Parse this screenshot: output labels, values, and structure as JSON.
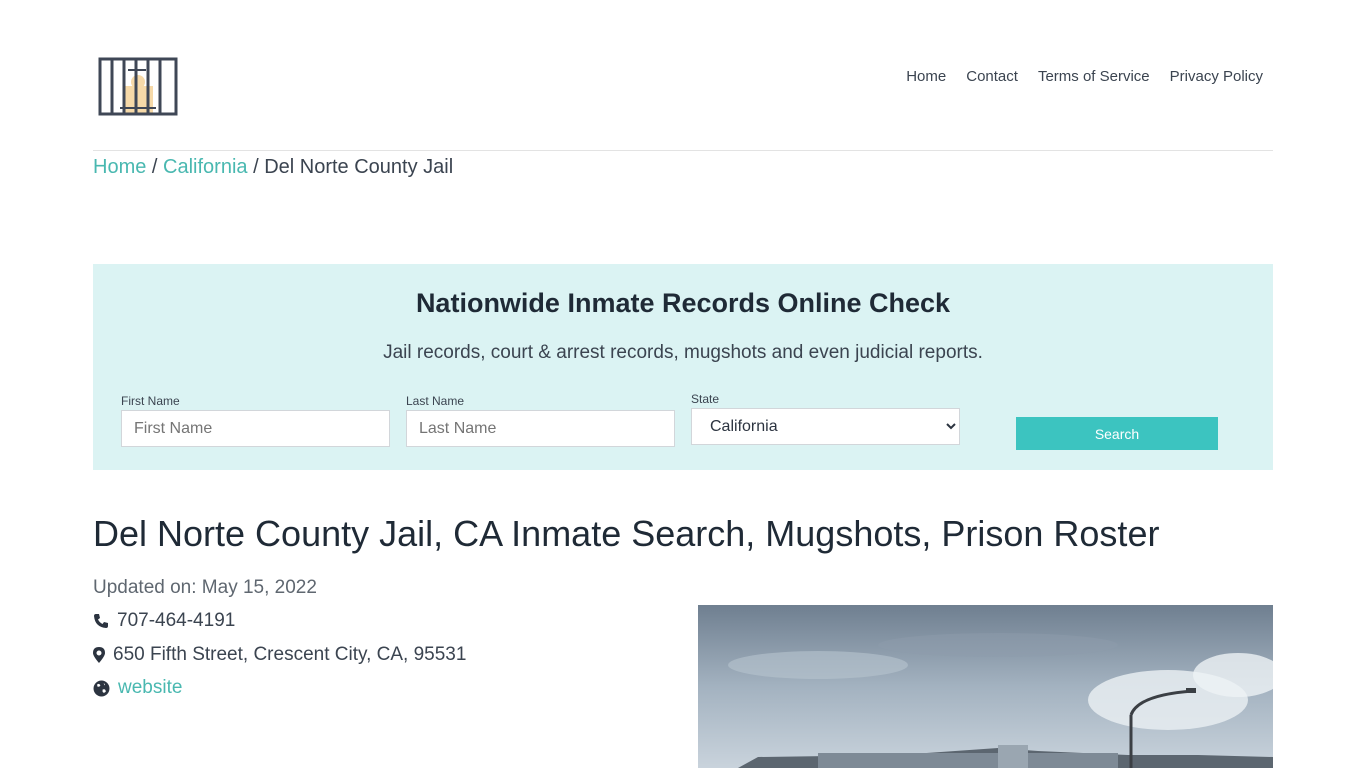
{
  "nav": {
    "items": [
      "Home",
      "Contact",
      "Terms of Service",
      "Privacy Policy"
    ]
  },
  "breadcrumb": {
    "home": "Home",
    "sep1": " / ",
    "state": "California",
    "sep2": " / ",
    "current": "Del Norte County Jail"
  },
  "search": {
    "title": "Nationwide Inmate Records Online Check",
    "subtitle": "Jail records, court & arrest records, mugshots and even judicial reports.",
    "first_name_label": "First Name",
    "first_name_placeholder": "First Name",
    "last_name_label": "Last Name",
    "last_name_placeholder": "Last Name",
    "state_label": "State",
    "state_value": "California",
    "button_label": "Search"
  },
  "main": {
    "title": "Del Norte County Jail, CA Inmate Search, Mugshots, Prison Roster",
    "updated": "Updated on: May 15, 2022",
    "phone": "707-464-4191",
    "address": "650 Fifth Street, Crescent City, CA, 95531",
    "website": "website"
  },
  "colors": {
    "accent": "#49b8b0",
    "button": "#3cc4c0",
    "search_bg": "#dbf3f3"
  }
}
